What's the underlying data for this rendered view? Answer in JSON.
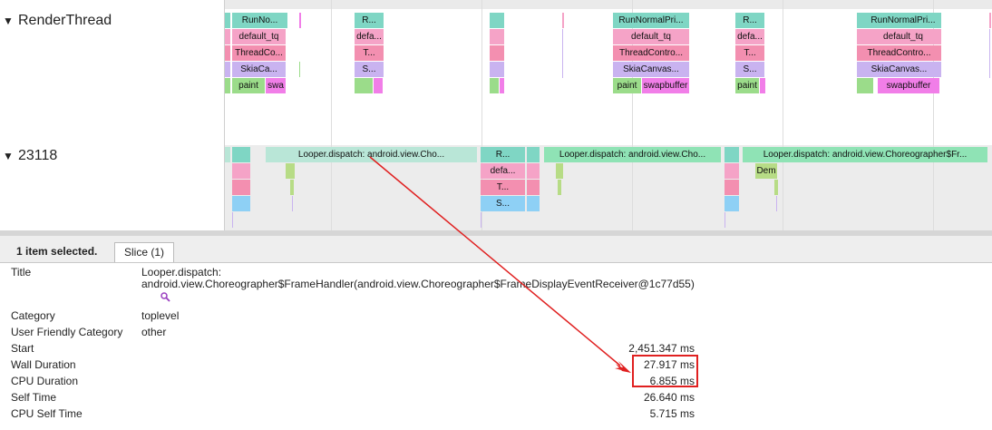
{
  "tracks": {
    "render_thread": {
      "toggle": "▼",
      "name": "RenderThread"
    },
    "process": {
      "toggle": "▼",
      "name": "23118"
    }
  },
  "colors": {
    "teal": "#7fd6c4",
    "pink": "#f5a3c7",
    "rose": "#f38fb0",
    "lavender": "#c9b3f0",
    "green": "#9bdc8a",
    "magenta": "#f17ee8",
    "olive": "#b7dc86",
    "blue": "#8ed0f5",
    "light_teal": "#b9e6d7",
    "mint": "#8fe3b5",
    "arrow": "#e02020"
  },
  "render_slices": {
    "row1": [
      "RunNo...",
      "R...",
      "RunNormalPri...",
      "R...",
      "RunNormalPri..."
    ],
    "row2": [
      "default_tq",
      "defa...",
      "default_tq",
      "defa...",
      "default_tq"
    ],
    "row3": [
      "ThreadCo...",
      "T...",
      "ThreadContro...",
      "T...",
      "ThreadContro..."
    ],
    "row4": [
      "SkiaCa...",
      "S...",
      "SkiaCanvas...",
      "S...",
      "SkiaCanvas..."
    ],
    "row5_paint": [
      "paint",
      "paint",
      "paint"
    ],
    "row5_swap": [
      "swa",
      "swapbuffer",
      "swapbuffer"
    ]
  },
  "process_slices": {
    "looper": [
      "Looper.dispatch: android.view.Cho...",
      "Looper.dispatch: android.view.Cho...",
      "Looper.dispatch: android.view.Choreographer$Fr..."
    ],
    "mid": [
      "R...",
      "defa...",
      "T...",
      "S..."
    ],
    "dem": "Dem"
  },
  "panel": {
    "selection": "1 item selected.",
    "tab": "Slice (1)",
    "rows": [
      {
        "label": "Title",
        "value": "Looper.dispatch:",
        "value2": "android.view.Choreographer$FrameHandler(android.view.Choreographer$FrameDisplayEventReceiver@1c77d55)"
      },
      {
        "label": "Category",
        "value": "toplevel"
      },
      {
        "label": "User Friendly Category",
        "value": "other"
      },
      {
        "label": "Start",
        "value": "2,451.347 ms"
      },
      {
        "label": "Wall Duration",
        "value": "27.917 ms"
      },
      {
        "label": "CPU Duration",
        "value": "6.855 ms"
      },
      {
        "label": "Self Time",
        "value": "26.640 ms"
      },
      {
        "label": "CPU Self Time",
        "value": "5.715 ms"
      }
    ]
  }
}
